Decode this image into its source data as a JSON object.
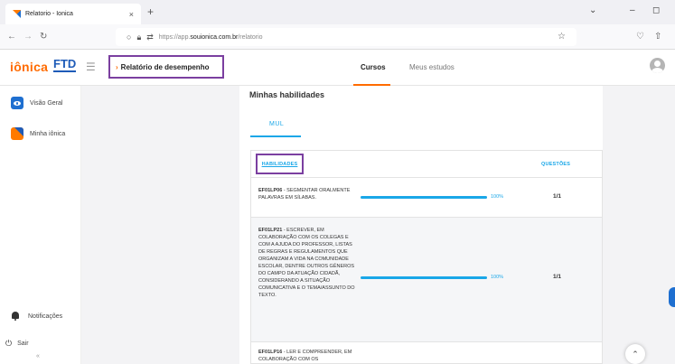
{
  "browser": {
    "tab_title": "Relatorio - Ionica",
    "tab_close": "×",
    "new_tab": "+",
    "url_prefix": "https://app.",
    "url_domain": "souionica.com.br",
    "url_path": "/relatorio"
  },
  "header": {
    "logo_ionica": "iônica",
    "logo_ftd": "FTD",
    "breadcrumb": "Relatório de desempenho",
    "tabs": [
      {
        "label": "Cursos",
        "active": true
      },
      {
        "label": "Meus estudos",
        "active": false
      }
    ]
  },
  "sidebar": {
    "items": [
      {
        "label": "Visão Geral"
      },
      {
        "label": "Minha iônica"
      }
    ],
    "notifications": "Notificações",
    "logout": "Sair",
    "collapse": "«"
  },
  "main": {
    "section_title": "Minhas habilidades",
    "sub_tab": "MUL",
    "table": {
      "col_habilidades": "HABILIDADES",
      "col_questoes": "QUESTÕES",
      "rows": [
        {
          "code": "EF01LP06",
          "description": " - SEGMENTAR ORALMENTE PALAVRAS EM SÍLABAS.",
          "progress": 100,
          "progress_label": "100%",
          "questions": "1/1"
        },
        {
          "code": "EF01LP21",
          "description": " - ESCREVER, EM COLABORAÇÃO COM OS COLEGAS E COM A AJUDA DO PROFESSOR, LISTAS DE REGRAS E REGULAMENTOS QUE ORGANIZAM A VIDA NA COMUNIDADE ESCOLAR, DENTRE OUTROS GÊNEROS DO CAMPO DA ATUAÇÃO CIDADÃ, CONSIDERANDO A SITUAÇÃO COMUNICATIVA E O TEMA/ASSUNTO DO TEXTO.",
          "progress": 100,
          "progress_label": "100%",
          "questions": "1/1"
        },
        {
          "code": "EF01LP16",
          "description": " - LER E COMPREENDER, EM COLABORAÇÃO COM OS",
          "progress": null,
          "progress_label": "",
          "questions": ""
        }
      ]
    }
  },
  "colors": {
    "accent_orange": "#ff6b00",
    "accent_blue": "#1aa7e8",
    "brand_blue": "#1e5bb8",
    "highlight_purple": "#7b3fa0"
  }
}
